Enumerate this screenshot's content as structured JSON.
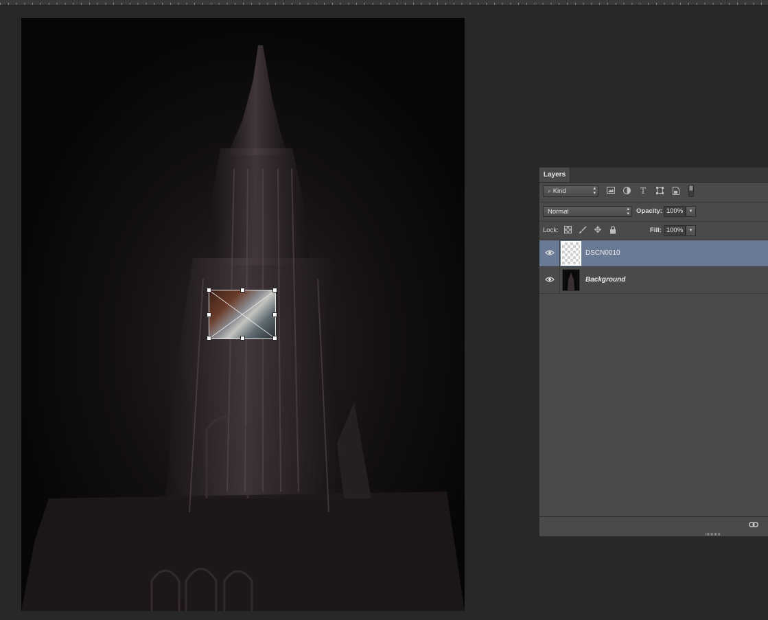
{
  "document": {
    "canvas_background": "#070607"
  },
  "layers_panel": {
    "tab_label": "Layers",
    "filter": {
      "selected": "Kind",
      "icon": "search-icon"
    },
    "filter_icons": [
      "image-filter-icon",
      "adjustment-filter-icon",
      "type-filter-icon",
      "shape-filter-icon",
      "smart-object-filter-icon",
      "filter-toggle-icon"
    ],
    "blend_mode": "Normal",
    "opacity_label": "Opacity:",
    "opacity_value": "100%",
    "lock_label": "Lock:",
    "lock_icons": [
      "lock-transparent-pixels-icon",
      "lock-image-pixels-icon",
      "lock-position-icon",
      "lock-all-icon"
    ],
    "fill_label": "Fill:",
    "fill_value": "100%",
    "layers": [
      {
        "name": "DSCN0010",
        "selected": true,
        "visible": true
      },
      {
        "name": "Background",
        "selected": false,
        "visible": true,
        "locked_style_italic": true
      }
    ],
    "footer_icon": "link-layers-icon",
    "selection_color": "#6b7a94"
  }
}
